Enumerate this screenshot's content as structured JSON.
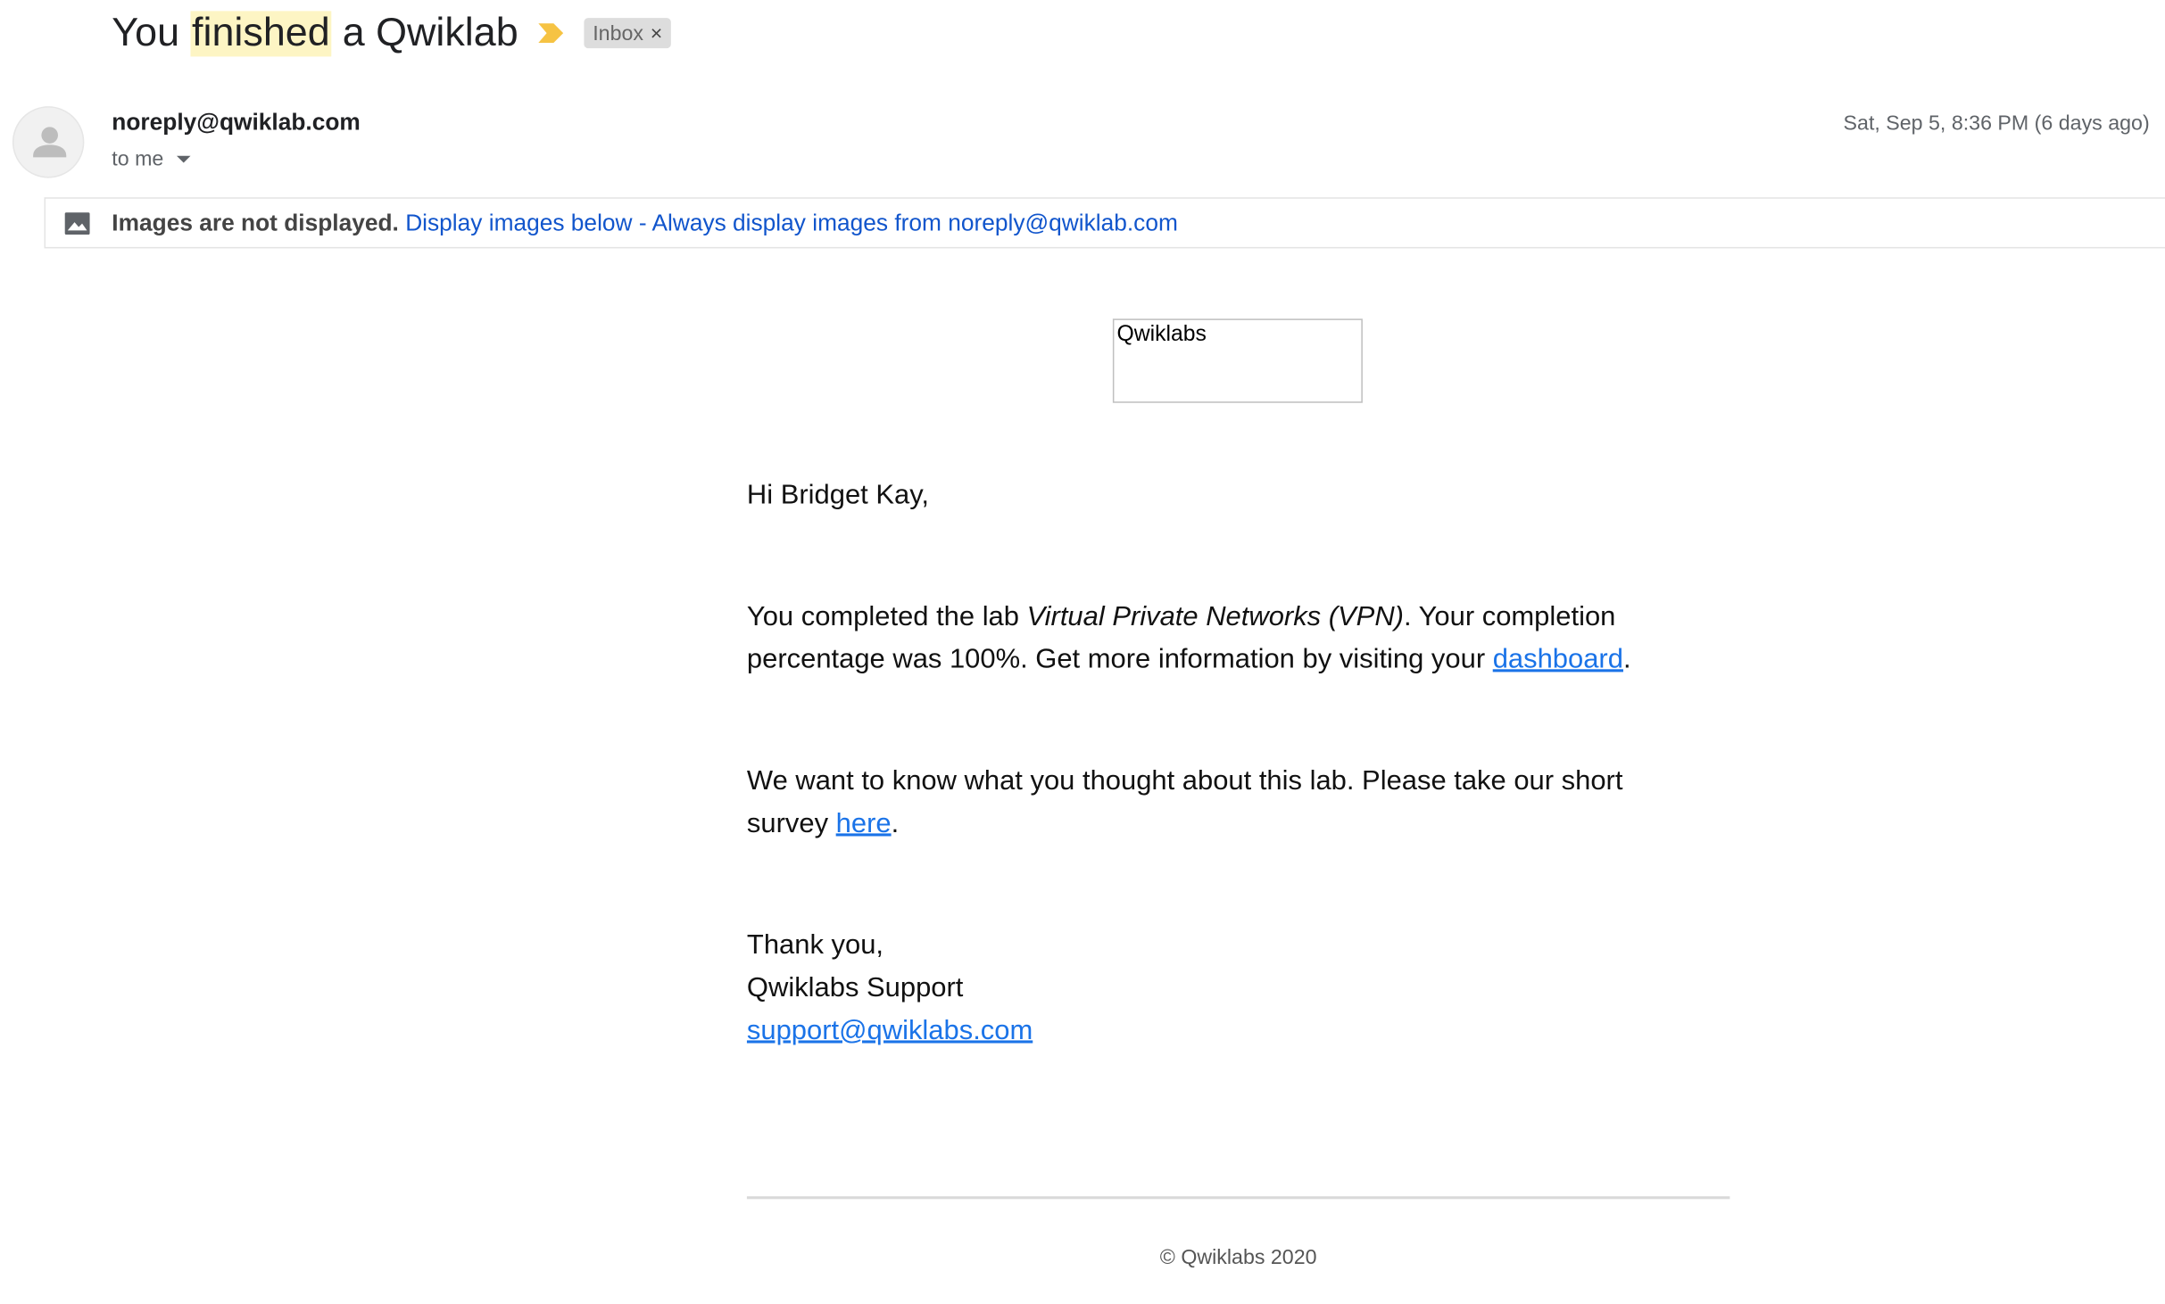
{
  "header": {
    "subject_prefix": "You ",
    "subject_highlight": "finished",
    "subject_suffix": " a Qwiklab",
    "label": "Inbox",
    "label_remove": "×"
  },
  "message": {
    "sender": "noreply@qwiklab.com",
    "recipient": "to me",
    "date": "Sat, Sep 5, 8:36 PM (6 days ago)"
  },
  "images_bar": {
    "notice": "Images are not displayed.",
    "display_below": "Display images below",
    "separator": " - ",
    "always_display": "Always display images from noreply@qwiklab.com"
  },
  "email": {
    "logo_alt": "Qwiklabs",
    "greeting": "Hi Bridget Kay,",
    "para1_a": "You completed the lab ",
    "para1_lab": "Virtual Private Networks (VPN)",
    "para1_b": ". Your completion percentage was 100%. Get more information by visiting your ",
    "para1_link": "dashboard",
    "para1_end": ".",
    "para2_a": "We want to know what you thought about this lab. Please take our short survey ",
    "para2_link": "here",
    "para2_end": ".",
    "signoff_1": "Thank you,",
    "signoff_2": "Qwiklabs Support",
    "signoff_email": "support@qwiklabs.com",
    "footer": "© Qwiklabs 2020"
  },
  "colors": {
    "highlight": "#fdf5c4",
    "link": "#1a73e8",
    "gmail_link": "#1155cc",
    "importance": "#f6c343"
  }
}
